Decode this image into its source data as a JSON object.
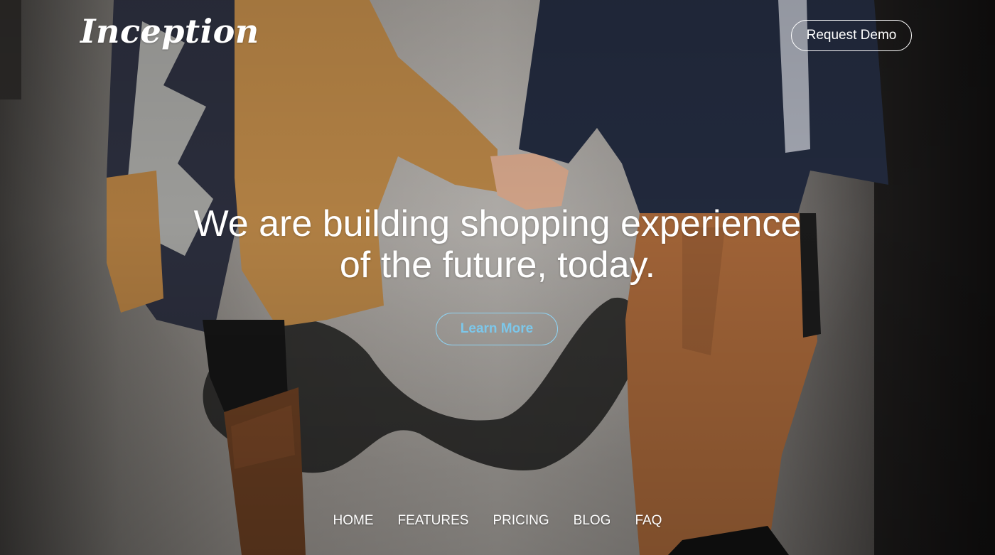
{
  "brand": {
    "logo_text": "Inception"
  },
  "header": {
    "request_demo_label": "Request Demo"
  },
  "hero": {
    "headline_line1": "We are building shopping experience",
    "headline_line2": "of the future, today.",
    "cta_label": "Learn More",
    "background_image": "couple-holding-hands-photo"
  },
  "footer_nav": {
    "items": [
      {
        "label": "HOME"
      },
      {
        "label": "FEATURES"
      },
      {
        "label": "PRICING"
      },
      {
        "label": "BLOG"
      },
      {
        "label": "FAQ"
      }
    ]
  },
  "colors": {
    "text": "#ffffff",
    "cta_border": "#8fd3f2",
    "cta_text": "#7cc7ea"
  }
}
